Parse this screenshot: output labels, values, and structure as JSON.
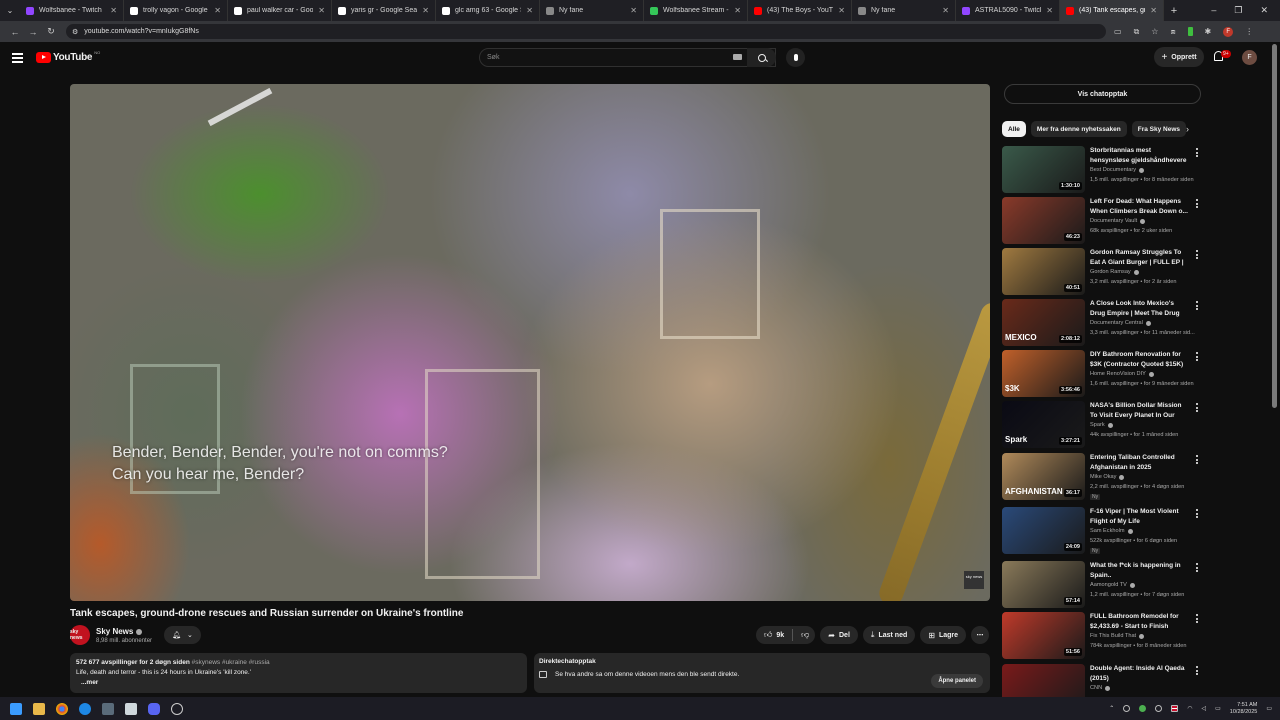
{
  "browser": {
    "tabs": [
      {
        "title": "Wolfsbanee - Twitch",
        "color": "#9146ff",
        "active": false
      },
      {
        "title": "trolly vagon - Google Search",
        "color": "#ffffff",
        "active": false
      },
      {
        "title": "paul walker car - Google Search",
        "color": "#ffffff",
        "active": false
      },
      {
        "title": "yaris gr - Google Search",
        "color": "#ffffff",
        "active": false
      },
      {
        "title": "glc amg 63 - Google Search",
        "color": "#ffffff",
        "active": false
      },
      {
        "title": "Ny fane",
        "color": "#888888",
        "active": false
      },
      {
        "title": "Wolfsbanee Stream - Watch",
        "color": "#35c759",
        "active": false
      },
      {
        "title": "(43) The Boys - YouTube",
        "color": "#ff0000",
        "active": false
      },
      {
        "title": "Ny fane",
        "color": "#888888",
        "active": false
      },
      {
        "title": "ASTRAL5090 - Twitch",
        "color": "#9146ff",
        "active": false
      },
      {
        "title": "(43) Tank escapes, gro",
        "color": "#ff0000",
        "active": true
      }
    ],
    "url": "youtube.com/watch?v=mnIukgG8fNs",
    "profile_letter": "F"
  },
  "yt_header": {
    "logo_text": "YouTube",
    "country_code": "NO",
    "search_placeholder": "Søk",
    "create_label": "Opprett",
    "notif_count": "9+",
    "avatar_letter": "F"
  },
  "player": {
    "subtitle_line1": "Bender, Bender, Bender, you're not on comms?",
    "subtitle_line2": "Can you hear me, Bender?",
    "badge_text": "sky news"
  },
  "video": {
    "title": "Tank escapes, ground-drone rescues and Russian surrender on Ukraine's frontline",
    "channel": "Sky News",
    "channel_avatar_text": "sky news",
    "subscribers": "8,98 mill. abonnenter",
    "likes": "9k",
    "share_label": "Del",
    "download_label": "Last ned",
    "save_label": "Lagre",
    "description": {
      "views_age": "572 677 avspillinger  for 2 døgn siden",
      "tags": "#skynews #ukraine #russia",
      "text": "Life, death and terror - this is 24 hours in Ukraine's 'kill zone.'",
      "more": "...mer"
    },
    "live_chat": {
      "title": "Direktechatopptak",
      "text": "Se hva andre sa om denne videoen mens den ble sendt direkte.",
      "open_label": "Åpne panelet"
    }
  },
  "sidebar": {
    "chat_replay_label": "Vis chatopptak",
    "chips": [
      "Alle",
      "Mer fra denne nyhetssaken",
      "Fra Sky News"
    ],
    "recommendations": [
      {
        "title": "Storbritannias mest hensynsløse gjeldshåndhevere",
        "channel": "Best Documentary",
        "meta": "1,5 mill. avspillinger • for 8 måneder siden",
        "duration": "1:30:10",
        "bg": "#3a5a4a",
        "thumb_text": "",
        "new": ""
      },
      {
        "title": "Left For Dead: What Happens When Climbers Break Down o...",
        "channel": "Documentary Vault",
        "meta": "68k avspillinger • for 2 uker siden",
        "duration": "46:23",
        "bg": "#8a3a2a",
        "thumb_text": "",
        "new": ""
      },
      {
        "title": "Gordon Ramsay Struggles To Eat A Giant Burger | FULL EP | ...",
        "channel": "Gordon Ramsay",
        "meta": "3,2 mill. avspillinger • for 2 år siden",
        "duration": "40:51",
        "bg": "#a07a40",
        "thumb_text": "",
        "new": ""
      },
      {
        "title": "A Close Look Into Mexico's Drug Empire | Meet The Drug Lords:...",
        "channel": "Documentary Central",
        "meta": "3,3 mill. avspillinger • for 11 måneder sid...",
        "duration": "2:08:12",
        "bg": "#6a2a1a",
        "thumb_text": "MEXICO",
        "new": ""
      },
      {
        "title": "DIY Bathroom Renovation for $3K (Contractor Quoted $15K)",
        "channel": "Home RenoVision DIY",
        "meta": "1,6 mill. avspillinger • for 9 måneder siden",
        "duration": "3:56:46",
        "bg": "#c0602a",
        "thumb_text": "$3K",
        "new": ""
      },
      {
        "title": "NASA's Billion Dollar Mission To Visit Every Planet In Our Solar ...",
        "channel": "Spark",
        "meta": "44k avspillinger • for 1 måned siden",
        "duration": "3:27:21",
        "bg": "#0a0a14",
        "thumb_text": "Spark",
        "new": ""
      },
      {
        "title": "Entering Taliban Controlled Afghanistan in 2025",
        "channel": "Mike Okay",
        "meta": "2,2 mill. avspillinger • for 4 døgn siden",
        "duration": "36:17",
        "bg": "#b08a5a",
        "thumb_text": "AFGHANISTAN",
        "new": "Ny"
      },
      {
        "title": "F-16 Viper | The Most Violent Flight of My Life",
        "channel": "Sam Eckholm",
        "meta": "522k avspillinger • for 6 døgn siden",
        "duration": "24:09",
        "bg": "#2a4a7a",
        "thumb_text": "",
        "new": "Ny"
      },
      {
        "title": "What the f*ck is happening in Spain..",
        "channel": "Aamongold TV",
        "meta": "1,2 mill. avspillinger • for 7 døgn siden",
        "duration": "57:14",
        "bg": "#8a7a5a",
        "thumb_text": "",
        "new": ""
      },
      {
        "title": "FULL Bathroom Remodel for $2,433.69 - Start to Finish",
        "channel": "Fix This Build That",
        "meta": "784k avspillinger • for 8 måneder siden",
        "duration": "51:56",
        "bg": "#c03a2a",
        "thumb_text": "",
        "new": ""
      },
      {
        "title": "Double Agent: Inside Al Qaeda (2015)",
        "channel": "CNN",
        "meta": "",
        "duration": "",
        "bg": "#7a1a1a",
        "thumb_text": "",
        "new": ""
      }
    ]
  },
  "taskbar": {
    "time": "7:51 AM",
    "date": "10/28/2025"
  }
}
